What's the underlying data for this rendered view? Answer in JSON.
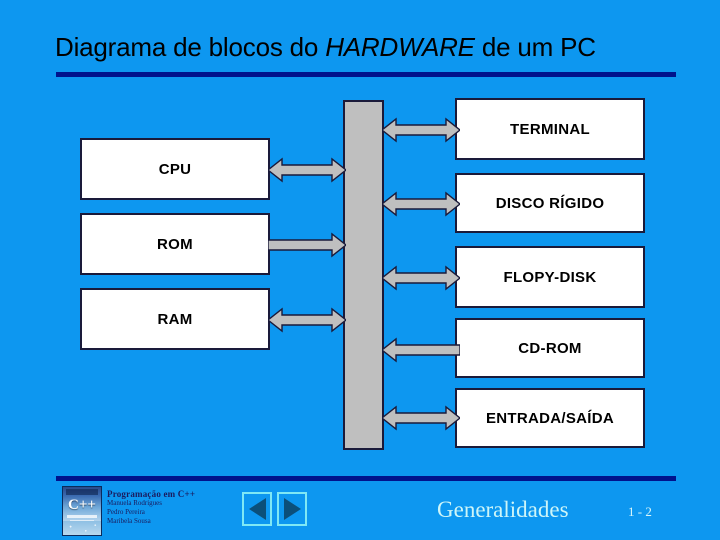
{
  "slide": {
    "background_color": "#0d97f0",
    "rule_color": "#00128c",
    "title_prefix": "Diagrama de blocos do ",
    "title_emphasis": "HARDWARE",
    "title_suffix": " de um PC"
  },
  "diagram": {
    "bus": {
      "name": "BUS",
      "color": "#bfbfbf"
    },
    "left_blocks": [
      {
        "label": "CPU",
        "arrow": "both"
      },
      {
        "label": "ROM",
        "arrow": "right"
      },
      {
        "label": "RAM",
        "arrow": "both"
      }
    ],
    "right_blocks": [
      {
        "label": "TERMINAL",
        "arrow": "both"
      },
      {
        "label": "DISCO RÍGIDO",
        "arrow": "both"
      },
      {
        "label": "FLOPY-DISK",
        "arrow": "both"
      },
      {
        "label": "CD-ROM",
        "arrow": "left"
      },
      {
        "label": "ENTRADA/SAÍDA",
        "arrow": "both"
      }
    ]
  },
  "footer": {
    "book_cover_title": "C++",
    "book_title": "Programação em C++",
    "authors": [
      "Manuela Rodrigues",
      "Pedro Pereira",
      "Maribela Sousa"
    ],
    "prev_label": "◀",
    "next_label": "▶",
    "section_label": "Generalidades",
    "page_number": "1 - 2"
  }
}
